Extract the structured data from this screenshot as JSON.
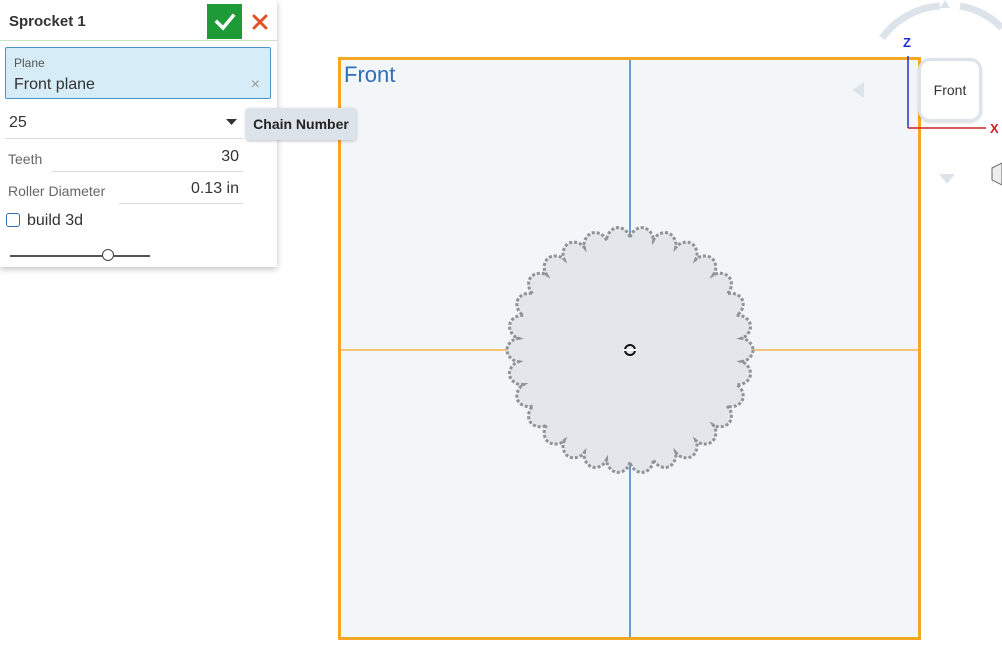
{
  "dialog": {
    "title": "Sprocket 1",
    "plane": {
      "label": "Plane",
      "value": "Front plane",
      "clear_icon": "close-icon"
    },
    "chain_number": {
      "value": "25",
      "tooltip": "Chain Number"
    },
    "teeth": {
      "label": "Teeth",
      "value": "30"
    },
    "roller_diameter": {
      "label": "Roller Diameter",
      "value": "0.13 in"
    },
    "build3d": {
      "label": "build 3d",
      "checked": false
    },
    "slider": {
      "fraction": 0.7
    }
  },
  "viewport": {
    "plane_name": "Front",
    "view_cube": {
      "face": "Front",
      "axis_z": "Z",
      "axis_x": "X"
    }
  },
  "colors": {
    "accept": "#1e9a36",
    "cancel": "#e0522a",
    "plane_border": "#f5a623",
    "plane_label": "#2e6fb5",
    "sprocket_fill": "#e3e6ea",
    "sprocket_edge": "#8f9296"
  }
}
